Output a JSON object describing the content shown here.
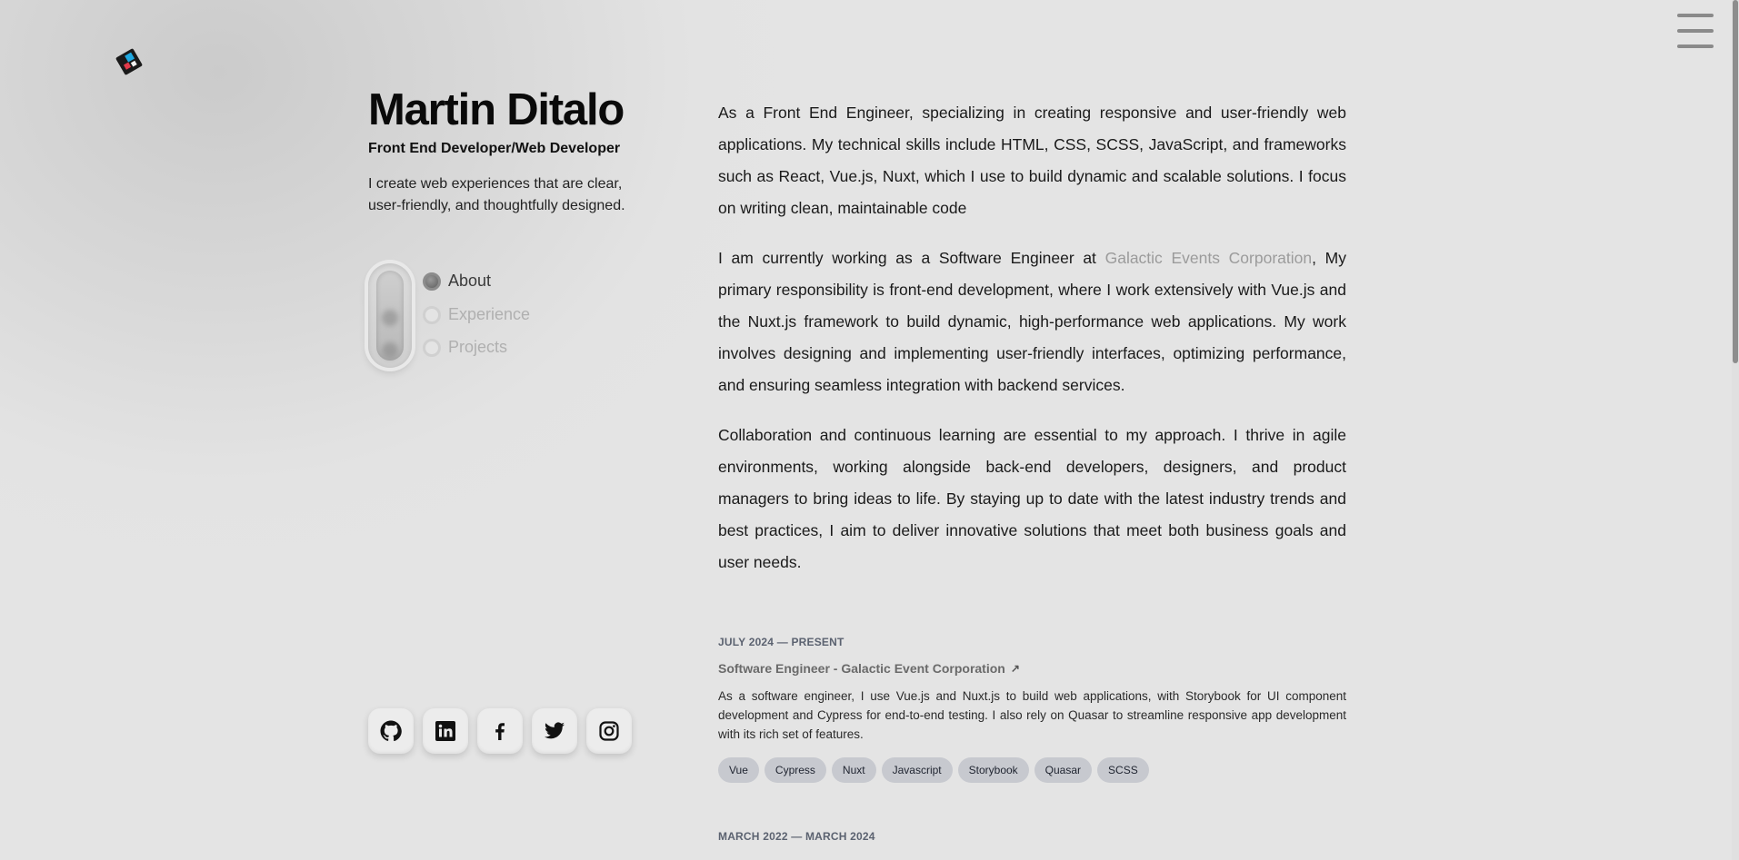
{
  "header": {
    "logo_icon": "diamond-logo-icon",
    "menu_icon": "hamburger-menu-icon"
  },
  "profile": {
    "name": "Martin Ditalo",
    "role": "Front End Developer/Web Developer",
    "tagline": "I create web experiences that are clear, user-friendly, and thoughtfully designed."
  },
  "nav": {
    "items": [
      {
        "label": "About",
        "active": true
      },
      {
        "label": "Experience",
        "active": false
      },
      {
        "label": "Projects",
        "active": false
      }
    ]
  },
  "socials": [
    {
      "name": "github-icon"
    },
    {
      "name": "linkedin-icon"
    },
    {
      "name": "facebook-icon"
    },
    {
      "name": "twitter-icon"
    },
    {
      "name": "instagram-icon"
    }
  ],
  "about": {
    "p1": "As a Front End Engineer, specializing in creating responsive and user-friendly web applications. My technical skills include HTML, CSS, SCSS, JavaScript, and frameworks such as React, Vue.js, Nuxt, which I use to build dynamic and scalable solutions. I focus on writing clean, maintainable code",
    "p2_before": "I am currently working as a Software Engineer at ",
    "p2_link": "Galactic Events Corporation",
    "p2_after": ", My primary responsibility is front-end development, where I work extensively with Vue.js and the Nuxt.js framework to build dynamic, high-performance web applications. My work involves designing and implementing user-friendly interfaces, optimizing performance, and ensuring seamless integration with backend services.",
    "p3": "Collaboration and continuous learning are essential to my approach. I thrive in agile environments, working alongside back-end developers, designers, and product managers to bring ideas to life. By staying up to date with the latest industry trends and best practices, I aim to deliver innovative solutions that meet both business goals and user needs."
  },
  "experience": [
    {
      "date": "JULY 2024 — PRESENT",
      "title": "Software Engineer - Galactic Event Corporation",
      "description": "As a software engineer, I use Vue.js and Nuxt.js to build web applications, with Storybook for UI component development and Cypress for end-to-end testing. I also rely on Quasar to streamline responsive app development with its rich set of features.",
      "tags": [
        "Vue",
        "Cypress",
        "Nuxt",
        "Javascript",
        "Storybook",
        "Quasar",
        "SCSS"
      ]
    },
    {
      "date": "MARCH 2022 — MARCH 2024"
    }
  ]
}
